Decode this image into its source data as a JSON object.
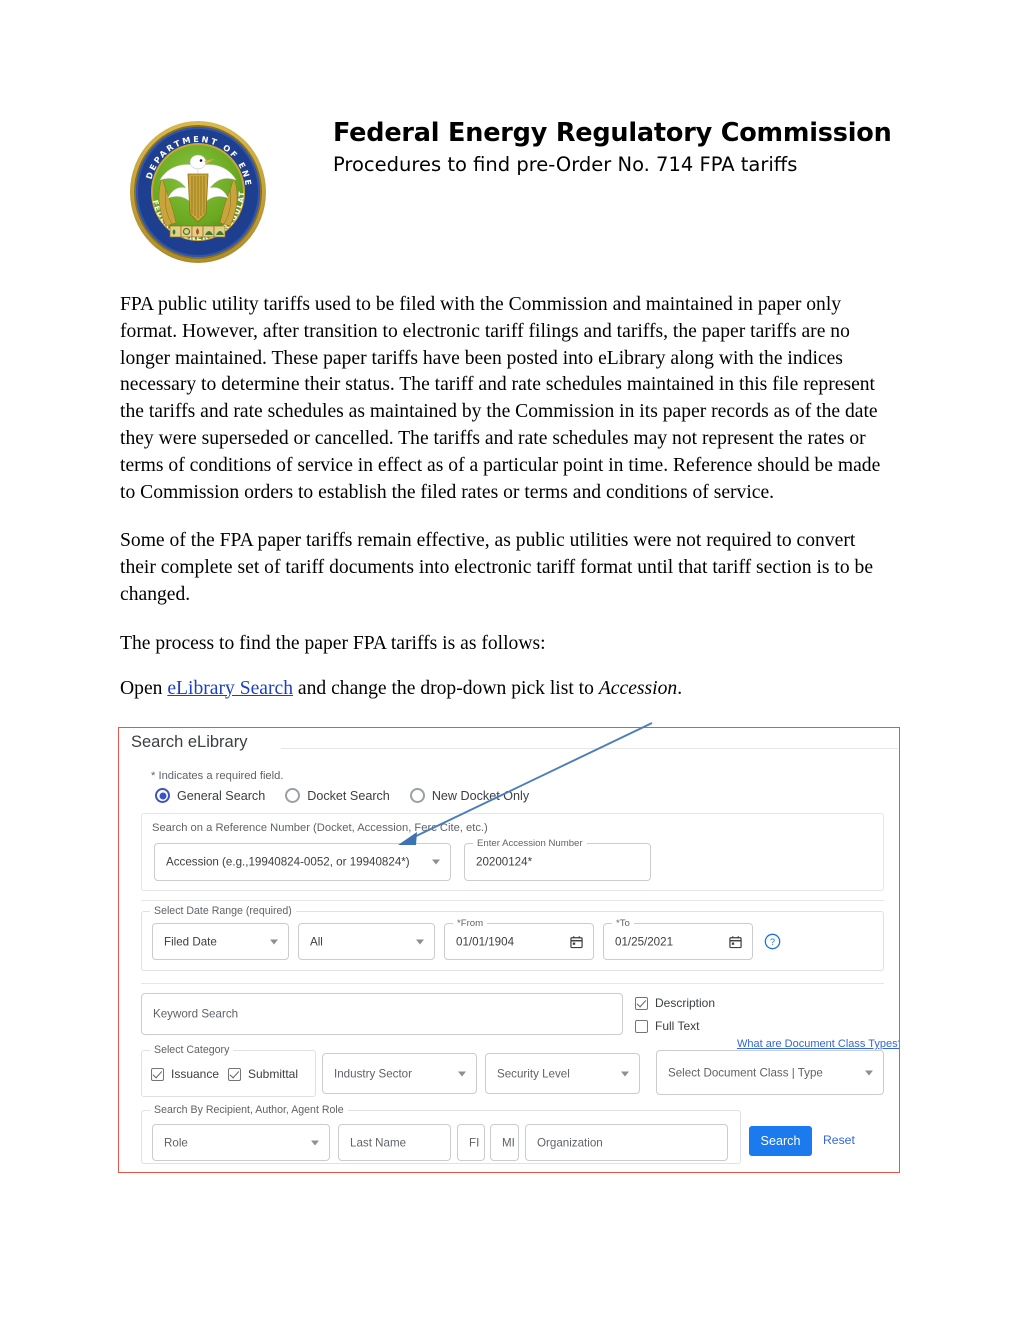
{
  "header": {
    "title": "Federal Energy Regulatory Commission",
    "subtitle": "Procedures to find pre-Order No. 714 FPA tariffs",
    "seal_outer_text": "DEPARTMENT OF ENERGY",
    "seal_inner_text": "FEDERAL ENERGY REGULATORY COMMISSION",
    "seal_accent": "#1e3f8f",
    "seal_center": "#6aa820"
  },
  "body": {
    "paragraph1": "FPA public utility tariffs used to be filed with the Commission and maintained in paper only format.   However, after transition to electronic tariff filings and tariffs, the paper tariffs are no longer maintained.  These paper tariffs have been posted into eLibrary along with the indices necessary to determine their status.  The tariff and rate schedules maintained in this file represent the tariffs and rate schedules as maintained by the Commission in its paper records as of the date they were superseded or cancelled.  The tariffs and rate schedules may not represent the rates or terms of conditions of service in effect as of a particular point in time.  Reference should be made to Commission orders to establish the filed rates or terms and conditions of service.",
    "paragraph2": "Some of the FPA paper tariffs remain effective, as public utilities were not required to convert their complete set of tariff documents into electronic tariff format until that tariff section is to be changed.",
    "paragraph3": "The process to find the paper FPA tariffs is as follows:",
    "paragraph4_pre": "Open ",
    "paragraph4_link": "eLibrary Search",
    "paragraph4_mid": " and change the drop-down pick list to ",
    "paragraph4_italic": "Accession",
    "paragraph4_post": "."
  },
  "screenshot": {
    "border_color": "#e8554a",
    "section_title": "Search eLibrary",
    "required_note": "* Indicates a required field.",
    "search_modes": [
      {
        "label": "General Search",
        "selected": true
      },
      {
        "label": "Docket Search",
        "selected": false
      },
      {
        "label": "New Docket Only",
        "selected": false
      }
    ],
    "reference_group": {
      "caption": "Search on a Reference Number (Docket, Accession, Ferc Cite, etc.)",
      "type_select_value": "Accession (e.g.,19940824-0052, or 19940824*)",
      "accession_label": "Enter Accession Number",
      "accession_value": "20200124*"
    },
    "date_group": {
      "legend": "Select Date Range (required)",
      "date_type_value": "Filed Date",
      "scope_value": "All",
      "from_label": "*From",
      "from_value": "01/01/1904",
      "to_label": "*To",
      "to_value": "01/25/2021",
      "help_icon": "help-circle-icon",
      "calendar_icon": "calendar-icon"
    },
    "keyword": {
      "placeholder": "Keyword Search",
      "checkboxes": [
        {
          "label": "Description",
          "checked": true
        },
        {
          "label": "Full Text",
          "checked": false
        }
      ]
    },
    "category_group": {
      "legend": "Select Category",
      "checkboxes": [
        {
          "label": "Issuance",
          "checked": true
        },
        {
          "label": "Submittal",
          "checked": true
        }
      ],
      "industry_sector": "Industry Sector",
      "security_level": "Security Level",
      "document_class": "Select Document Class | Type",
      "doc_class_link": "What are Document Class Types?"
    },
    "recipient_group": {
      "legend": "Search By Recipient, Author, Agent Role",
      "role": "Role",
      "last_name": "Last Name",
      "fi": "FI",
      "mi": "MI",
      "organization": "Organization"
    },
    "actions": {
      "search_label": "Search",
      "search_color": "#1b7aed",
      "reset_label": "Reset",
      "reset_color": "#3267d6"
    },
    "annotation": {
      "arrow_color": "#4a7ebb",
      "points_to": "reference-type-select"
    }
  }
}
